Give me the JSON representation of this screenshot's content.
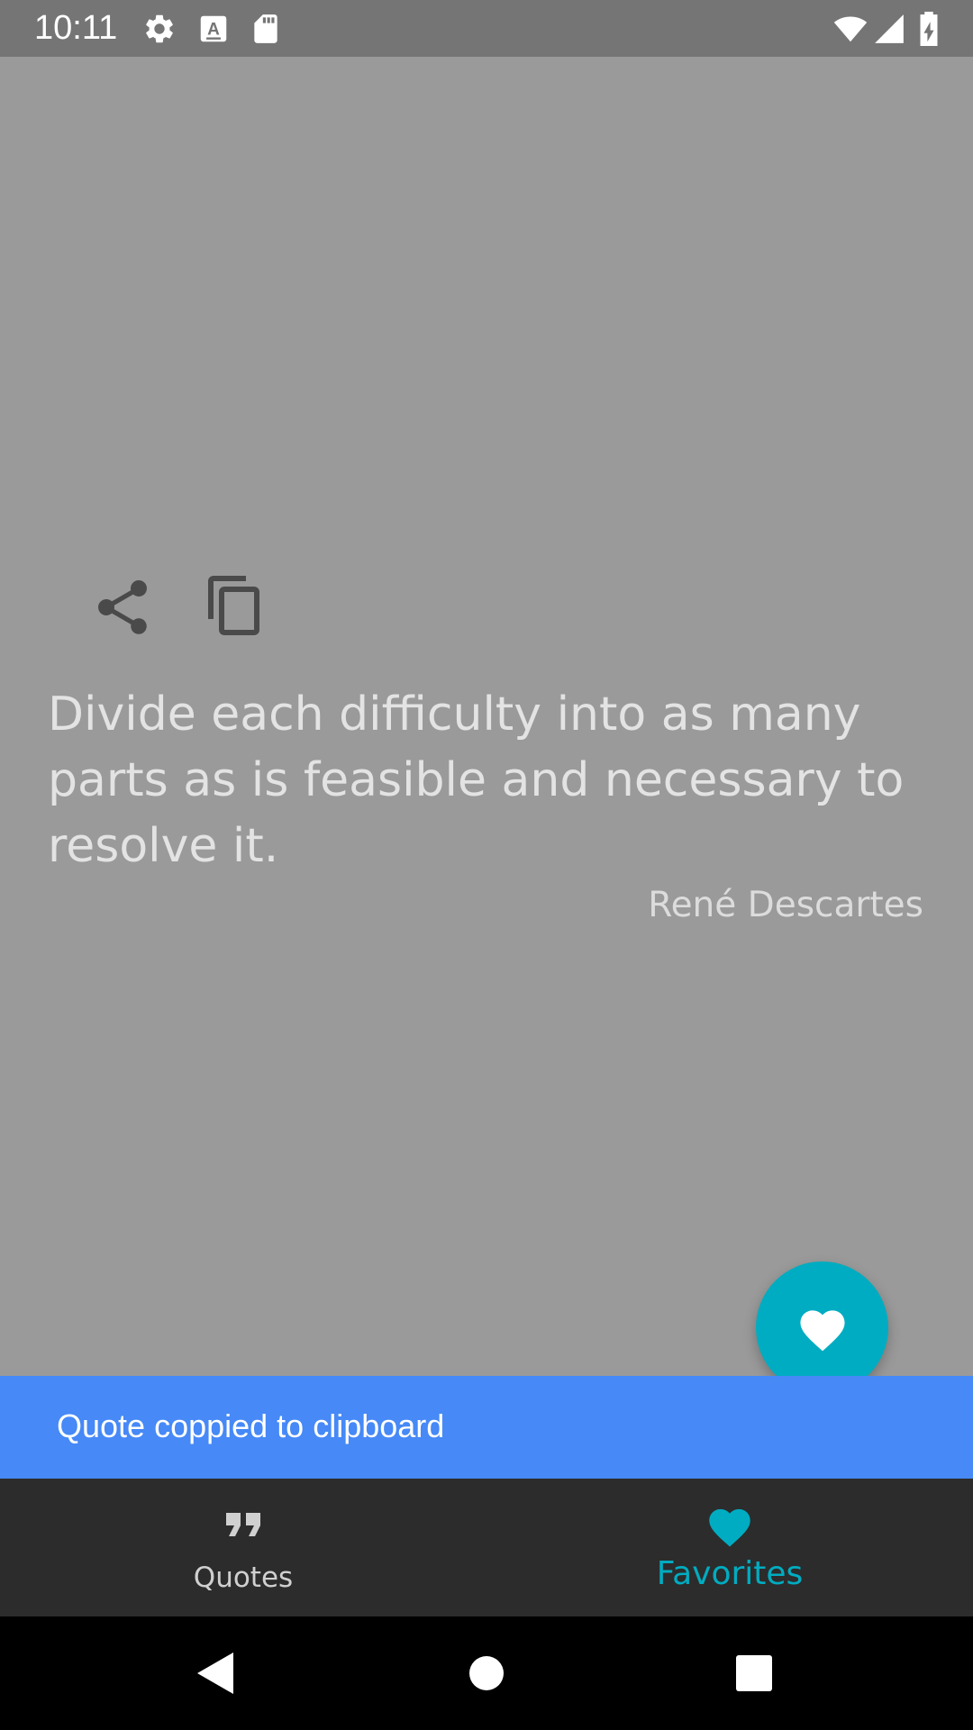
{
  "status_bar": {
    "time": "10:11",
    "icons": [
      "gear-icon",
      "keyboard-a-icon",
      "sd-card-icon",
      "wifi-icon",
      "signal-icon",
      "battery-charging-icon"
    ]
  },
  "actions": {
    "share_icon": "share-icon",
    "copy_icon": "copy-icon"
  },
  "quote": {
    "text": "Divide each difficulty into as many parts as is feasible and necessary to resolve it.",
    "author": "René Descartes"
  },
  "fab": {
    "icon": "heart-icon"
  },
  "snackbar": {
    "message": "Quote coppied to clipboard"
  },
  "bottom_nav": {
    "items": [
      {
        "label": "Quotes",
        "icon": "quote-marks-icon",
        "active": false
      },
      {
        "label": "Favorites",
        "icon": "heart-icon",
        "active": true
      }
    ]
  },
  "system_nav": {
    "buttons": [
      "back-icon",
      "home-icon",
      "recents-icon"
    ]
  },
  "colors": {
    "background": "#9a9a9a",
    "accent": "#00acc1",
    "snackbar": "#4689f7",
    "bottom_nav": "#2c2c2c",
    "status_bar": "#757575"
  }
}
